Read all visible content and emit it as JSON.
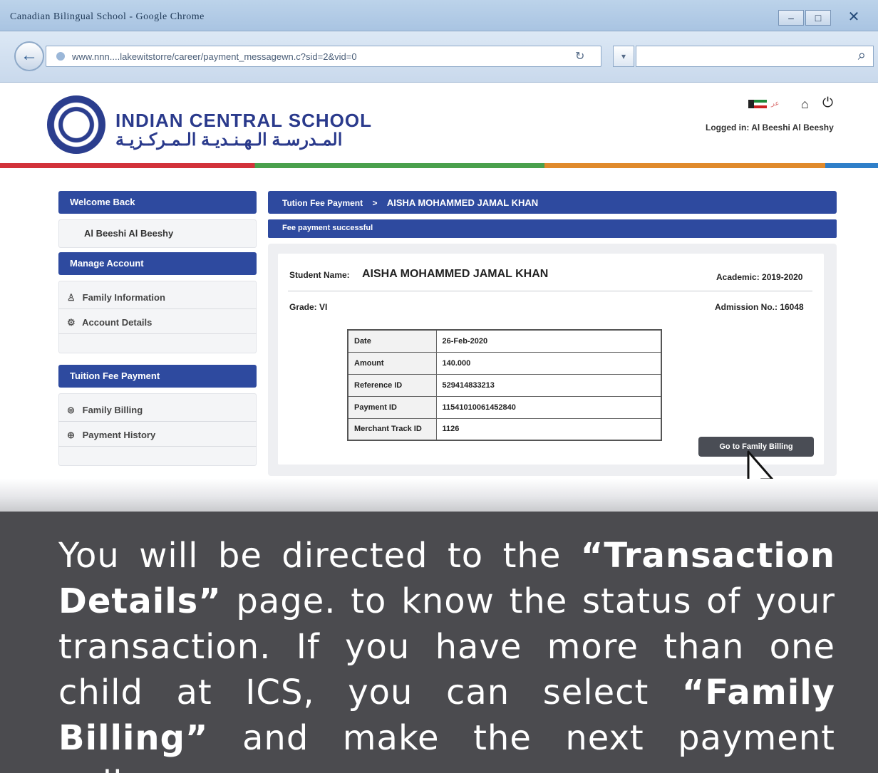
{
  "browser": {
    "window_title": "Canadian Bilingual School - Google Chrome",
    "url": "www.nnn....lakewitstorre/career/payment_messagewn.c?sid=2&vid=0",
    "reload_glyph": "↻",
    "dropdown_glyph": "▾",
    "back_glyph": "←",
    "search_glyph": "⌕",
    "minimize_glyph": "–",
    "maximize_glyph": "□",
    "close_glyph": "✕"
  },
  "header": {
    "school_name": "INDIAN CENTRAL SCHOOL",
    "school_name_ar": "المـدرسـة الـهـنـديـة الـمـركـزيـة",
    "logged_in": "Logged in: Al Beeshi Al Beeshy",
    "home_glyph": "⌂",
    "power_glyph": "⏻",
    "flag2_text": "عر"
  },
  "sidebar": {
    "welcome_heading": "Welcome Back",
    "user_name": "Al Beeshi Al Beeshy",
    "manage_heading": "Manage Account",
    "manage_items": [
      {
        "label": "Family Information",
        "icon": "user-icon",
        "glyph": "♙"
      },
      {
        "label": "Account Details",
        "icon": "gear-icon",
        "glyph": "⚙"
      }
    ],
    "tuition_heading": "Tuition Fee Payment",
    "tuition_items": [
      {
        "label": "Family Billing",
        "icon": "billing-icon",
        "glyph": "⊜"
      },
      {
        "label": "Payment History",
        "icon": "history-icon",
        "glyph": "⊕"
      }
    ]
  },
  "main": {
    "breadcrumb_section": "Tution Fee Payment",
    "breadcrumb_sep": ">",
    "breadcrumb_student": "AISHA MOHAMMED JAMAL KHAN",
    "status_message": "Fee payment successful",
    "student_name_label": "Student Name:",
    "student_name": "AISHA MOHAMMED JAMAL KHAN",
    "academic": "Academic: 2019-2020",
    "grade": "Grade: VI",
    "admission": "Admission No.: 16048",
    "transaction": [
      {
        "key": "Date",
        "value": "26-Feb-2020"
      },
      {
        "key": "Amount",
        "value": "140.000"
      },
      {
        "key": "Reference ID",
        "value": "529414833213"
      },
      {
        "key": "Payment ID",
        "value": "11541010061452840"
      },
      {
        "key": "Merchant Track ID",
        "value": "1126"
      }
    ],
    "go_button": "Go to Family Billing"
  },
  "caption": {
    "p1": "You will be directed to the ",
    "b1": "“Transaction Details”",
    "p2": " page. to know the status of your transaction. If you have more than one child at ICS, you can select ",
    "b2": "“Family Billing”",
    "p3": " and make the next payment online."
  },
  "colors": {
    "brand_blue": "#2e4a9f",
    "caption_bg": "#4b4b4f"
  }
}
